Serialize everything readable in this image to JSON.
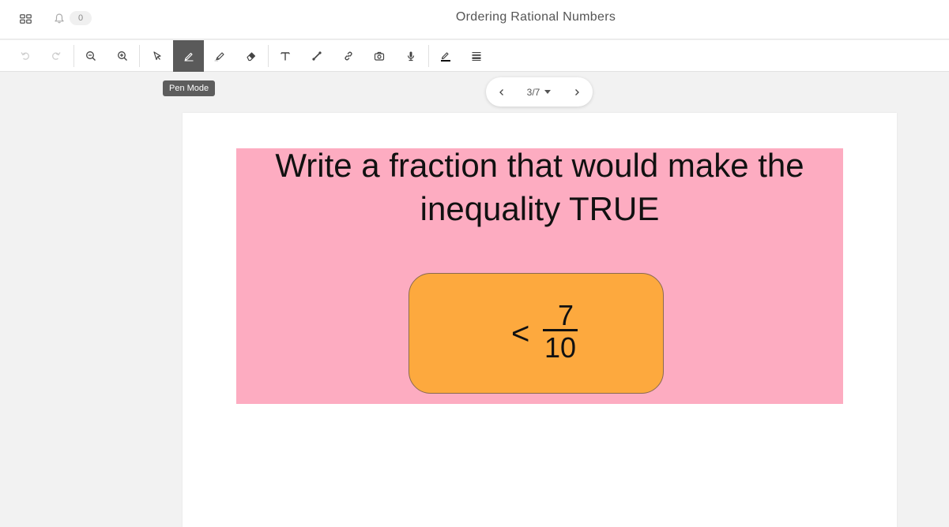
{
  "header": {
    "apps_icon": "grid-icon",
    "bell_icon": "bell-icon",
    "notification_count": "0",
    "title": "Ordering Rational Numbers"
  },
  "toolbar": {
    "tools": [
      {
        "name": "undo",
        "icon": "undo-icon",
        "enabled": false
      },
      {
        "name": "redo",
        "icon": "redo-icon",
        "enabled": false
      },
      {
        "name": "zoom-out",
        "icon": "zoom-out-icon"
      },
      {
        "name": "zoom-in",
        "icon": "zoom-in-icon"
      },
      {
        "name": "select",
        "icon": "cursor-icon"
      },
      {
        "name": "pen",
        "icon": "pen-icon",
        "active": true
      },
      {
        "name": "highlighter",
        "icon": "highlighter-icon"
      },
      {
        "name": "eraser",
        "icon": "eraser-icon"
      },
      {
        "name": "text",
        "icon": "text-icon"
      },
      {
        "name": "line",
        "icon": "line-icon"
      },
      {
        "name": "link",
        "icon": "link-icon"
      },
      {
        "name": "camera",
        "icon": "camera-icon"
      },
      {
        "name": "microphone",
        "icon": "microphone-icon"
      },
      {
        "name": "pen-color",
        "icon": "pen-color-icon",
        "color": "#111111"
      },
      {
        "name": "line-width",
        "icon": "line-width-icon"
      }
    ],
    "tooltip": "Pen Mode"
  },
  "pager": {
    "current": "3/7",
    "prev_icon": "chevron-left-icon",
    "next_icon": "chevron-right-icon"
  },
  "slide": {
    "question_line1": "Write a fraction that would make the",
    "question_line2": "inequality TRUE",
    "inequality_symbol": "<",
    "numerator": "7",
    "denominator": "10",
    "background_color": "#fdacc1",
    "box_color": "#fda93e"
  }
}
